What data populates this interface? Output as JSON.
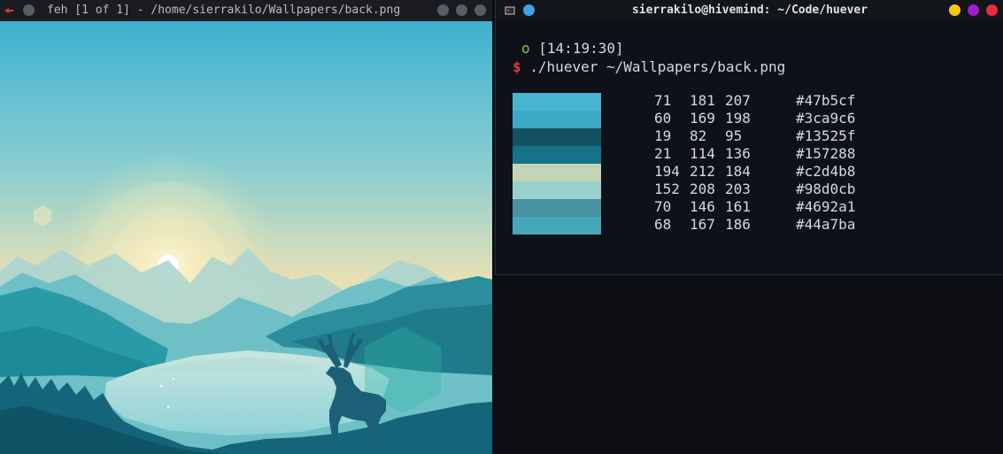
{
  "feh": {
    "title": "feh [1 of 1] - /home/sierrakilo/Wallpapers/back.png"
  },
  "terminal": {
    "title": "sierrakilo@hivemind: ~/Code/huever",
    "prompt_marker": "o",
    "time": "[14:19:30]",
    "prompt_symbol": "$",
    "command": "./huever ~/Wallpapers/back.png",
    "palette": [
      {
        "r": "71",
        "g": "181",
        "b": "207",
        "hex": "#47b5cf"
      },
      {
        "r": "60",
        "g": "169",
        "b": "198",
        "hex": "#3ca9c6"
      },
      {
        "r": "19",
        "g": "82",
        "b": "95",
        "hex": "#13525f"
      },
      {
        "r": "21",
        "g": "114",
        "b": "136",
        "hex": "#157288"
      },
      {
        "r": "194",
        "g": "212",
        "b": "184",
        "hex": "#c2d4b8"
      },
      {
        "r": "152",
        "g": "208",
        "b": "203",
        "hex": "#98d0cb"
      },
      {
        "r": "70",
        "g": "146",
        "b": "161",
        "hex": "#4692a1"
      },
      {
        "r": "68",
        "g": "167",
        "b": "186",
        "hex": "#44a7ba"
      }
    ],
    "controls": {
      "yellow": "#f6c90e",
      "purple": "#a41bcd",
      "red": "#ec2c45",
      "blue": "#3fa2e8"
    }
  }
}
